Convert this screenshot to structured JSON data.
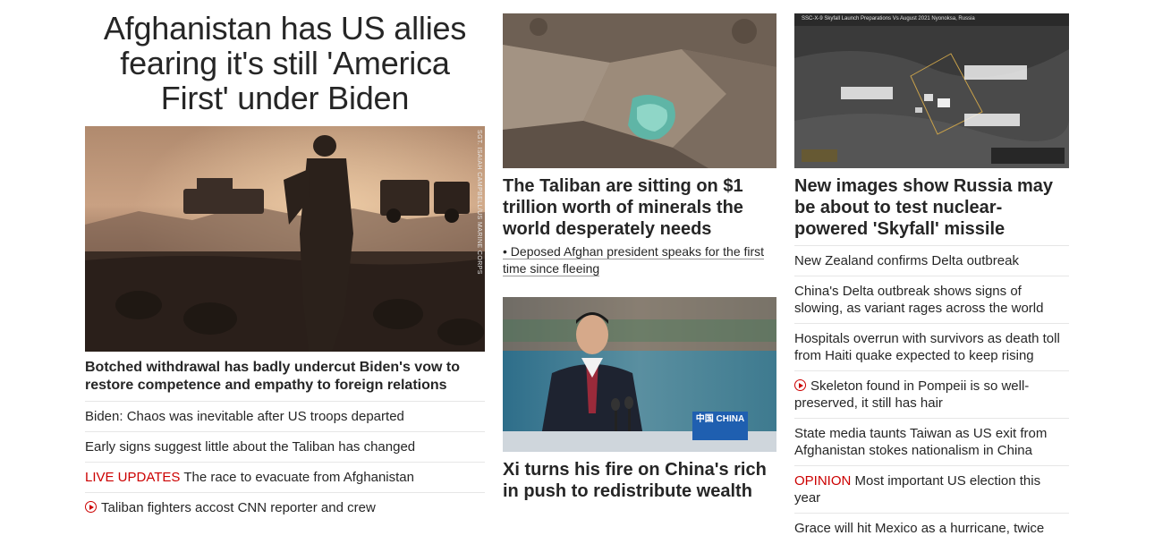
{
  "left": {
    "headline": "Afghanistan has US allies fearing it's still 'America First' under Biden",
    "photo_credit": "SGT. ISAIAH CAMPBELL/US MARINE CORPS",
    "sub_headline": "Botched withdrawal has badly undercut Biden's vow to restore competence and empathy to foreign relations",
    "links": [
      {
        "text": "Biden: Chaos was inevitable after US troops departed"
      },
      {
        "text": "Early signs suggest little about the Taliban has changed"
      },
      {
        "prefix": "LIVE UPDATES",
        "text": "The race to evacuate from Afghanistan"
      },
      {
        "icon": "play-icon",
        "text": "Taliban fighters accost CNN reporter and crew"
      }
    ]
  },
  "middle": {
    "story1": {
      "title": "The Taliban are sitting on $1 trillion worth of minerals the world desperately needs",
      "bullet": "• Deposed Afghan president speaks for the first time since fleeing"
    },
    "story2": {
      "podium_sign": "中国 CHINA",
      "title": "Xi turns his fire on China's rich in push to redistribute wealth"
    }
  },
  "right": {
    "satellite_caption": "SSC-X-9 Skyfall Launch Preparations  Vs August 2021  Nyonoksa, Russia",
    "title": "New images show Russia may be about to test nuclear-powered 'Skyfall' missile",
    "links": [
      {
        "text": "New Zealand confirms Delta outbreak"
      },
      {
        "text": "China's Delta outbreak shows signs of slowing, as variant rages across the world"
      },
      {
        "text": "Hospitals overrun with survivors as death toll from Haiti quake expected to keep rising"
      },
      {
        "icon": "play-icon",
        "text": "Skeleton found in Pompeii is so well-preserved, it still has hair"
      },
      {
        "text": "State media taunts Taiwan as US exit from Afghanistan stokes nationalism in China"
      },
      {
        "prefix": "OPINION",
        "text": "Most important US election this year"
      },
      {
        "text": "Grace will hit Mexico as a hurricane, twice"
      }
    ]
  },
  "colors": {
    "accent_red": "#cc0000",
    "text": "#262626",
    "divider": "#e6e6e6"
  }
}
